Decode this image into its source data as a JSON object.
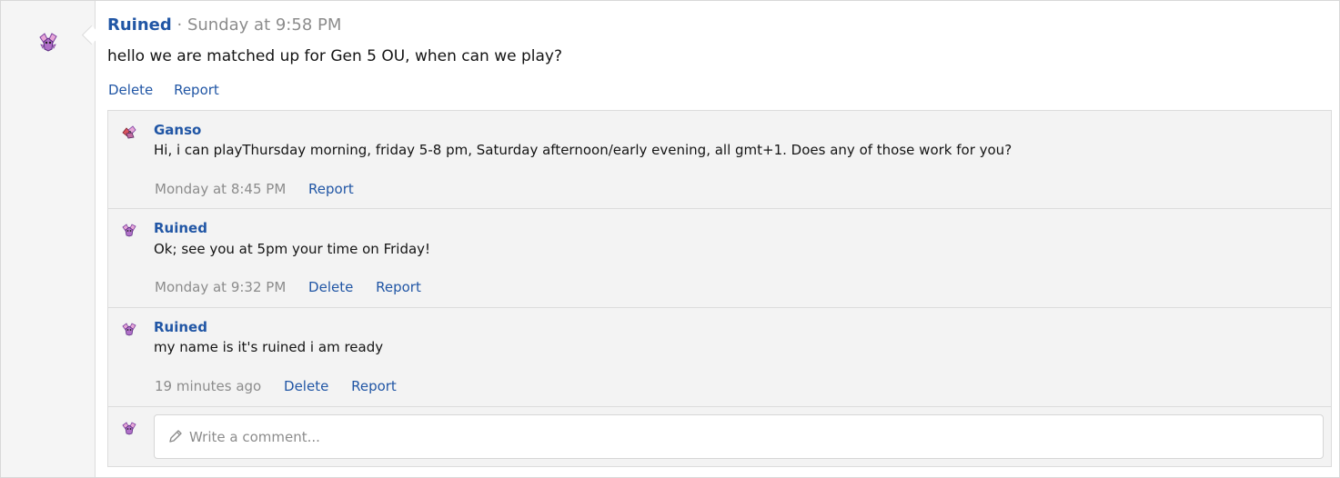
{
  "colors": {
    "link": "#2156a5",
    "muted": "#8c8c8c",
    "text": "#141414",
    "panel": "#f3f3f3",
    "border": "#dcdcdc",
    "avatar_pink": "#e7a6d6",
    "avatar_purple": "#7a3fa0"
  },
  "post": {
    "author": "Ruined",
    "separator": "·",
    "time": "Sunday at 9:58 PM",
    "body": "hello we are matched up for Gen 5 OU, when can we play?",
    "actions": {
      "delete": "Delete",
      "report": "Report"
    },
    "avatar_icon": "pokemon-sprite-avatar-icon"
  },
  "comments": [
    {
      "author": "Ganso",
      "text": "Hi, i can playThursday morning, friday 5-8 pm, Saturday afternoon/early evening, all gmt+1. Does any of those work for you?",
      "time": "Monday at 8:45 PM",
      "report": "Report"
    },
    {
      "author": "Ruined",
      "text": "Ok; see you at 5pm your time on Friday!",
      "time": "Monday at 9:32 PM",
      "delete": "Delete",
      "report": "Report"
    },
    {
      "author": "Ruined",
      "text": "my name is it's ruined i am ready",
      "time": "19 minutes ago",
      "delete": "Delete",
      "report": "Report"
    }
  ],
  "comment_box": {
    "placeholder": "Write a comment...",
    "icon": "pencil-icon"
  }
}
